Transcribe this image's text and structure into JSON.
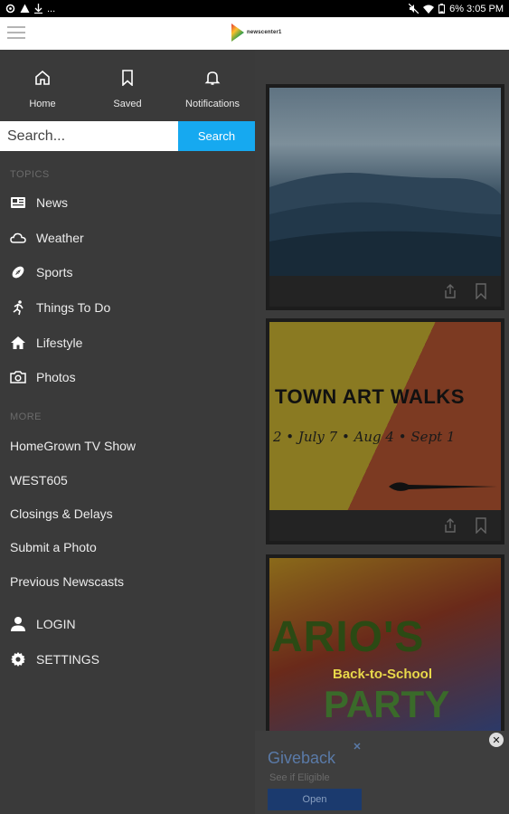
{
  "status_bar": {
    "right_text": "6% 3:05 PM",
    "left_text": "..."
  },
  "header": {
    "logo_text": "newscenter1"
  },
  "drawer": {
    "tabs": [
      {
        "label": "Home",
        "icon": "home-icon"
      },
      {
        "label": "Saved",
        "icon": "bookmark-icon"
      },
      {
        "label": "Notifications",
        "icon": "bell-icon"
      }
    ],
    "search": {
      "placeholder": "Search...",
      "button_label": "Search"
    },
    "topics_label": "TOPICS",
    "topics": [
      {
        "label": "News",
        "icon": "newspaper-icon"
      },
      {
        "label": "Weather",
        "icon": "cloud-icon"
      },
      {
        "label": "Sports",
        "icon": "football-icon"
      },
      {
        "label": "Things To Do",
        "icon": "running-icon"
      },
      {
        "label": "Lifestyle",
        "icon": "house-icon"
      },
      {
        "label": "Photos",
        "icon": "camera-icon"
      }
    ],
    "more_label": "MORE",
    "more_links": [
      "HomeGrown TV Show",
      "WEST605",
      "Closings & Delays",
      "Submit a Photo",
      "Previous Newscasts"
    ],
    "login_label": "LOGIN",
    "settings_label": "SETTINGS"
  },
  "content": {
    "art_walk_title": "TOWN ART WALKS",
    "art_walk_dates": "2 • July 7 • Aug 4 • Sept 1",
    "mario_title": "ARIO'S",
    "mario_sub": "Back-to-School",
    "mario_party": "PARTY"
  },
  "ad": {
    "title": "Giveback",
    "subtitle": "See if Eligible",
    "button_label": "Open",
    "close_label": "✕"
  },
  "colors": {
    "accent": "#16a9f0",
    "drawer_bg": "#3a3a3a",
    "status_bar_bg": "#000000"
  }
}
